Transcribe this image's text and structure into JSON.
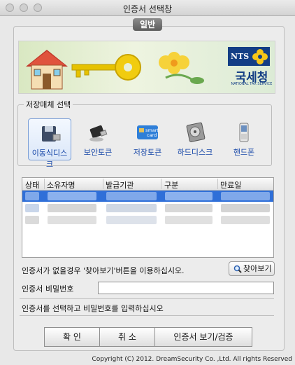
{
  "window": {
    "title": "인증서 선택창"
  },
  "tab": {
    "label": "일반"
  },
  "banner": {
    "logo_text": "NTS",
    "agency_name": "국세청",
    "agency_name_en": "NATIONAL TAX SERVICE"
  },
  "storage": {
    "legend": "저장매체 선택",
    "devices": [
      {
        "label": "이동식디스크",
        "icon": "removable-disk-icon",
        "selected": true
      },
      {
        "label": "보안토큰",
        "icon": "security-token-icon",
        "selected": false
      },
      {
        "label": "저장토큰",
        "icon": "smart-card-icon",
        "selected": false
      },
      {
        "label": "하드디스크",
        "icon": "hard-disk-icon",
        "selected": false
      },
      {
        "label": "핸드폰",
        "icon": "mobile-phone-icon",
        "selected": false
      }
    ],
    "smartcard_text": [
      "smart",
      "card"
    ]
  },
  "cert_table": {
    "columns": [
      "상태",
      "소유자명",
      "발급기관",
      "구분",
      "만료일"
    ]
  },
  "messages": {
    "no_cert_hint": "인증서가 없을경우 '찾아보기'버튼을 이용하십시오.",
    "find_button": "찾아보기",
    "password_label": "인증서 비밀번호",
    "status": "인증서를 선택하고 비밀번호를 입력하십시오"
  },
  "buttons": {
    "ok": "확 인",
    "cancel": "취 소",
    "view_verify": "인증서 보기/검증"
  },
  "footer": {
    "copyright": "Copyright (C) 2012. DreamSecurity Co. ,Ltd. All rights Reserved"
  },
  "colors": {
    "accent_blue": "#1747a8",
    "nts_blue": "#133e85",
    "selection_blue": "#2f6fd8"
  }
}
